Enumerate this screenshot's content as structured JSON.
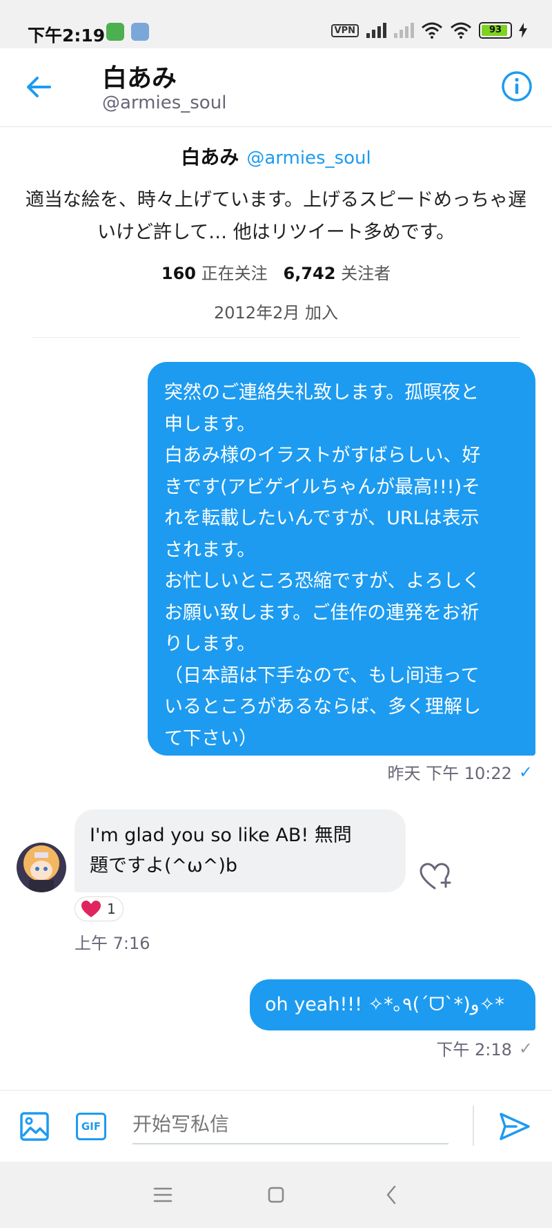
{
  "status_bar": {
    "time": "下午2:19",
    "vpn": "VPN",
    "battery": "93",
    "battery_level": 0.93
  },
  "header": {
    "name": "白あみ",
    "handle": "@armies_soul"
  },
  "profile": {
    "name": "白あみ",
    "handle": "@armies_soul",
    "bio": "適当な絵を、時々上げています。上げるスピードめっちゃ遅いけど許して… 他はリツイート多めです。",
    "following_count": "160",
    "following_label": "正在关注",
    "followers_count": "6,742",
    "followers_label": "关注者",
    "joined": "2012年2月 加入"
  },
  "messages": [
    {
      "direction": "out",
      "lines": [
        "突然のご連絡失礼致します。孤暝夜と",
        "申します。",
        "白あみ様のイラストがすばらしい、好",
        "きです(アビゲイルちゃんが最高!!!)そ",
        "れを転載したいんですが、URLは表示",
        "されます。",
        "お忙しいところ恐縮ですが、よろしく",
        "お願い致します。ご佳作の連発をお祈",
        "りします。",
        "（日本語は下手なので、もし间违って",
        "いるところがあるならば、多く理解し",
        "て下さい）"
      ],
      "time": "昨天 下午 10:22",
      "status_icon": "check-icon"
    },
    {
      "direction": "in",
      "lines": [
        "I'm glad you so like AB! 無問",
        "題ですよ(^ω^)b"
      ],
      "reaction_count": "1",
      "time": "上午 7:16"
    },
    {
      "direction": "out",
      "lines": [
        "oh yeah!!!  ✧*｡٩(ˊᗜˋ*)و✧*"
      ],
      "time": "下午 2:18",
      "status_icon": "check-icon"
    }
  ],
  "composer": {
    "placeholder": "开始写私信",
    "gif_label": "GIF"
  },
  "colors": {
    "accent": "#1d9bf0",
    "incoming_bubble": "#eff1f3"
  }
}
